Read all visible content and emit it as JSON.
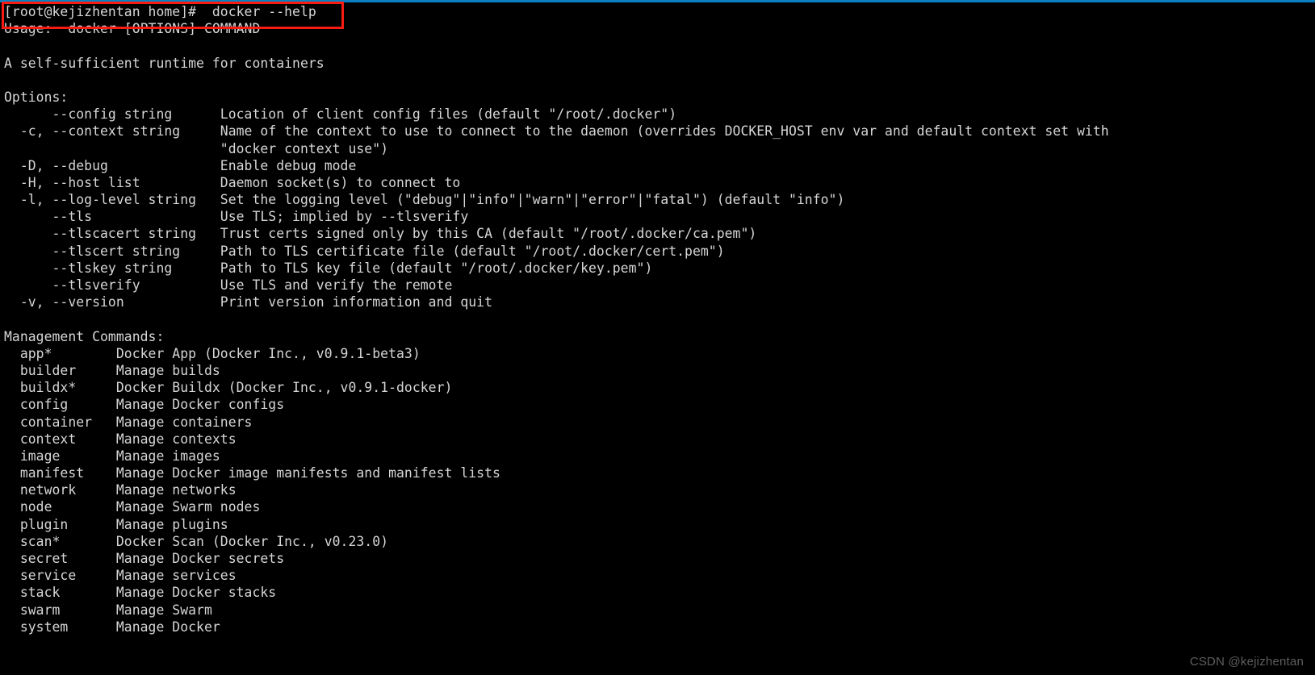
{
  "terminal": {
    "background_color": "#000000",
    "text_color": "#d6d6d6",
    "accent_bar_color": "#0a7fc2",
    "highlight_box_color": "#f81b12",
    "prompt_line": "[root@kejizhentan home]#  docker --help",
    "lines": [
      "[root@kejizhentan home]#  docker --help",
      "Usage:  docker [OPTIONS] COMMAND",
      "",
      "A self-sufficient runtime for containers",
      "",
      "Options:",
      "      --config string      Location of client config files (default \"/root/.docker\")",
      "  -c, --context string     Name of the context to use to connect to the daemon (overrides DOCKER_HOST env var and default context set with",
      "                           \"docker context use\")",
      "  -D, --debug              Enable debug mode",
      "  -H, --host list          Daemon socket(s) to connect to",
      "  -l, --log-level string   Set the logging level (\"debug\"|\"info\"|\"warn\"|\"error\"|\"fatal\") (default \"info\")",
      "      --tls                Use TLS; implied by --tlsverify",
      "      --tlscacert string   Trust certs signed only by this CA (default \"/root/.docker/ca.pem\")",
      "      --tlscert string     Path to TLS certificate file (default \"/root/.docker/cert.pem\")",
      "      --tlskey string      Path to TLS key file (default \"/root/.docker/key.pem\")",
      "      --tlsverify          Use TLS and verify the remote",
      "  -v, --version            Print version information and quit",
      "",
      "Management Commands:",
      "  app*        Docker App (Docker Inc., v0.9.1-beta3)",
      "  builder     Manage builds",
      "  buildx*     Docker Buildx (Docker Inc., v0.9.1-docker)",
      "  config      Manage Docker configs",
      "  container   Manage containers",
      "  context     Manage contexts",
      "  image       Manage images",
      "  manifest    Manage Docker image manifests and manifest lists",
      "  network     Manage networks",
      "  node        Manage Swarm nodes",
      "  plugin      Manage plugins",
      "  scan*       Docker Scan (Docker Inc., v0.23.0)",
      "  secret      Manage Docker secrets",
      "  service     Manage services",
      "  stack       Manage Docker stacks",
      "  swarm       Manage Swarm",
      "  system      Manage Docker"
    ]
  },
  "watermark": {
    "text": "CSDN @kejizhentan"
  }
}
